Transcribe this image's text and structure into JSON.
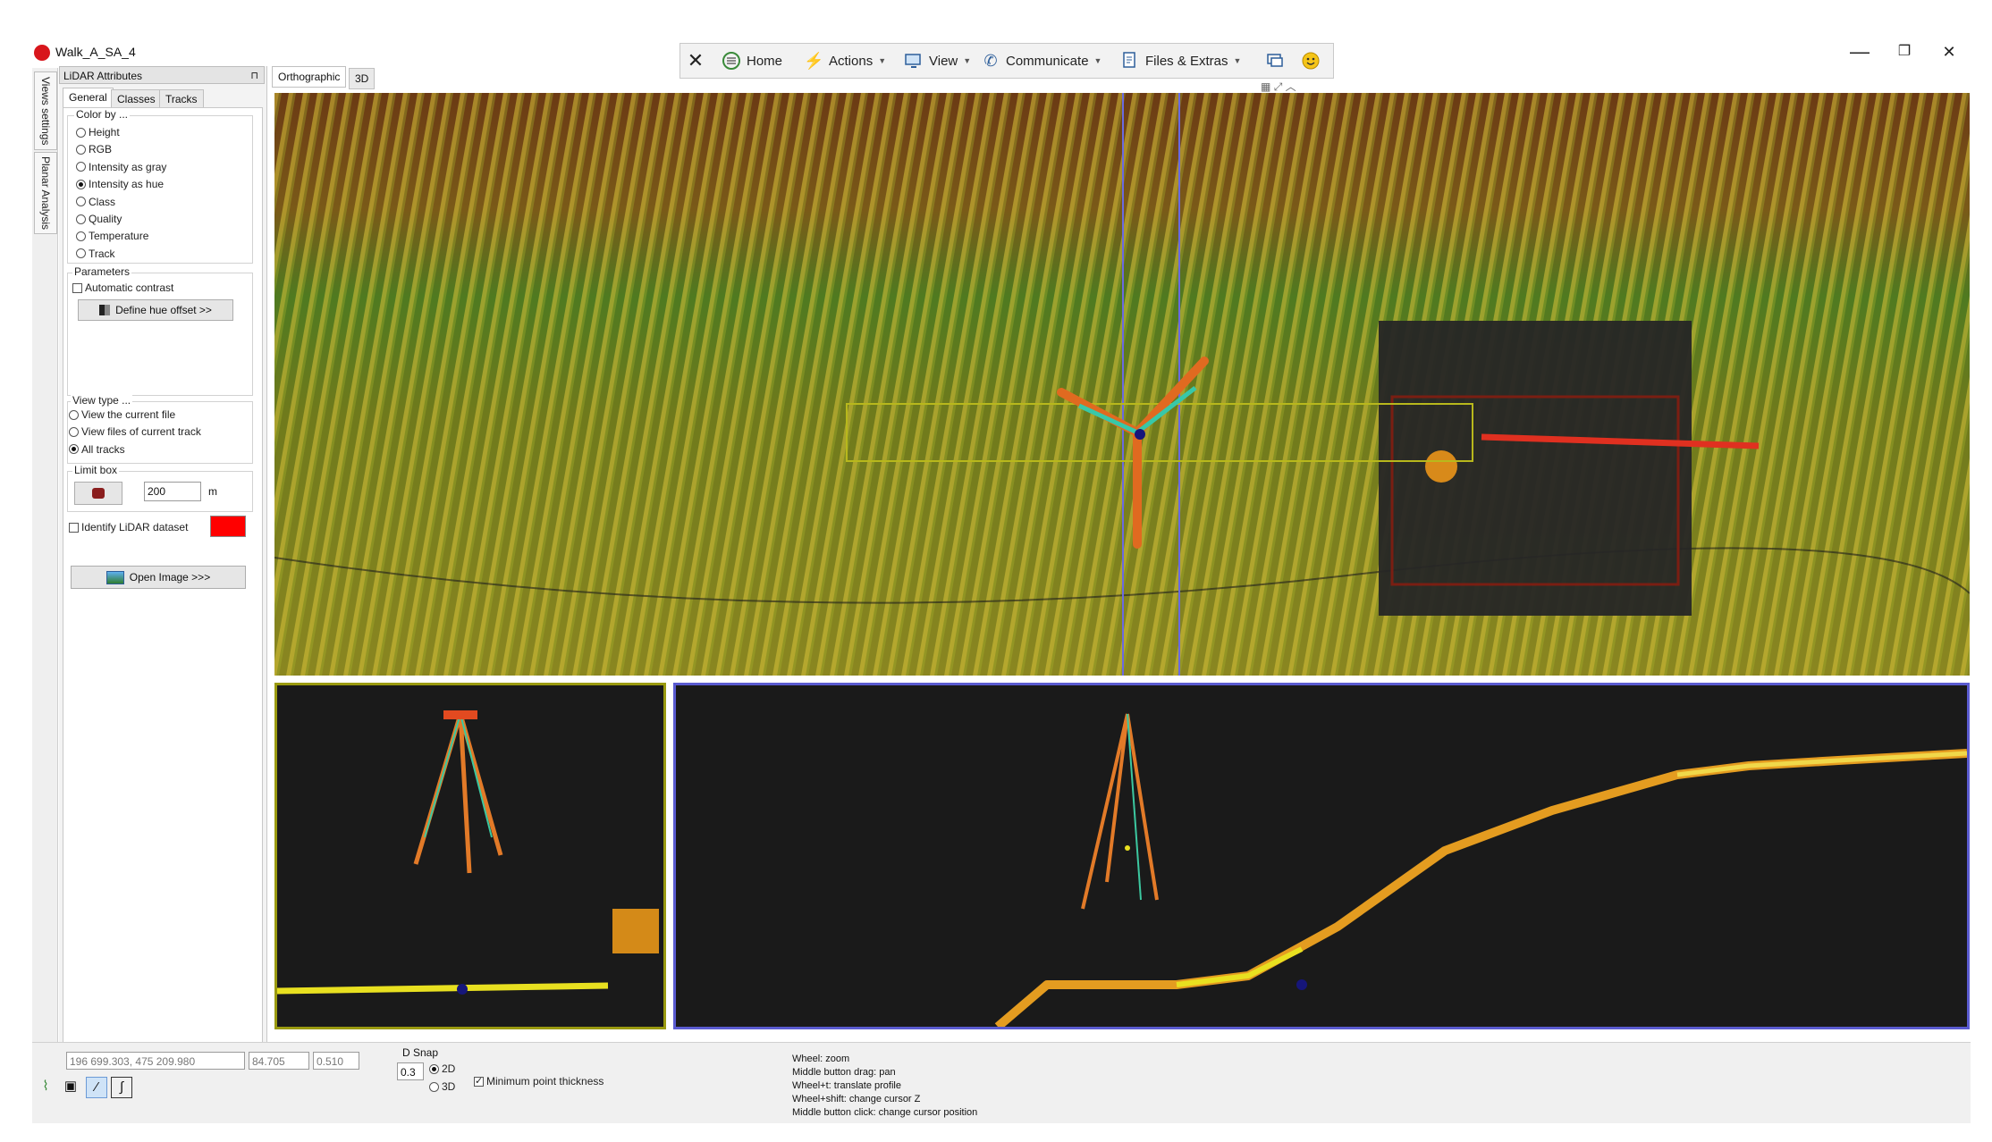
{
  "window": {
    "title": "Walk_A_SA_4",
    "minimize": "—",
    "restore": "❐",
    "close": "✕"
  },
  "toolbar": {
    "close_icon": "✕",
    "home": "Home",
    "actions": "Actions",
    "view": "View",
    "communicate": "Communicate",
    "files_extras": "Files & Extras",
    "caret": "▼"
  },
  "side_tabs": [
    "Views settings",
    "Planar Analysis"
  ],
  "panel": {
    "title": "LiDAR Attributes",
    "pin": "📌",
    "tabs": [
      "General",
      "Classes",
      "Tracks"
    ],
    "color_by": {
      "label": "Color by ...",
      "options": [
        "Height",
        "RGB",
        "Intensity as gray",
        "Intensity as hue",
        "Class",
        "Quality",
        "Temperature",
        "Track"
      ],
      "selected": "Intensity as hue"
    },
    "parameters": {
      "label": "Parameters",
      "automatic_contrast": "Automatic contrast",
      "automatic_contrast_checked": false,
      "define_hue_offset": "Define hue offset >>"
    },
    "view_type": {
      "label": "View type ...",
      "options": [
        "View the current file",
        "View files of current track",
        "All tracks"
      ],
      "selected": "All tracks"
    },
    "limit_box": {
      "label": "Limit box",
      "value": "200",
      "unit": "m"
    },
    "identify": {
      "label": "Identify LiDAR dataset",
      "checked": false,
      "color": "#ff0000"
    },
    "open_image": "Open Image >>>"
  },
  "view_tabs": [
    "Orthographic",
    "3D"
  ],
  "status": {
    "coords": "196 699.303,  475 209.980",
    "z": "84.705",
    "val": "0.510",
    "d_snap_label": "D Snap",
    "d_snap_value": "0.3",
    "mode_2d": "2D",
    "mode_3d": "3D",
    "mode_selected": "2D",
    "min_point_thickness": "Minimum point thickness",
    "min_point_thickness_checked": true,
    "help_lines": [
      "Wheel: zoom",
      "Middle button drag: pan",
      "Wheel+t: translate profile",
      "Wheel+shift: change cursor Z",
      "Middle button click: change cursor position"
    ]
  },
  "colors": {
    "view_bg": "#121212",
    "profile_left_border": "#9a9a10",
    "profile_right_border": "#5a5bd0",
    "accent_red": "#d8161c"
  }
}
